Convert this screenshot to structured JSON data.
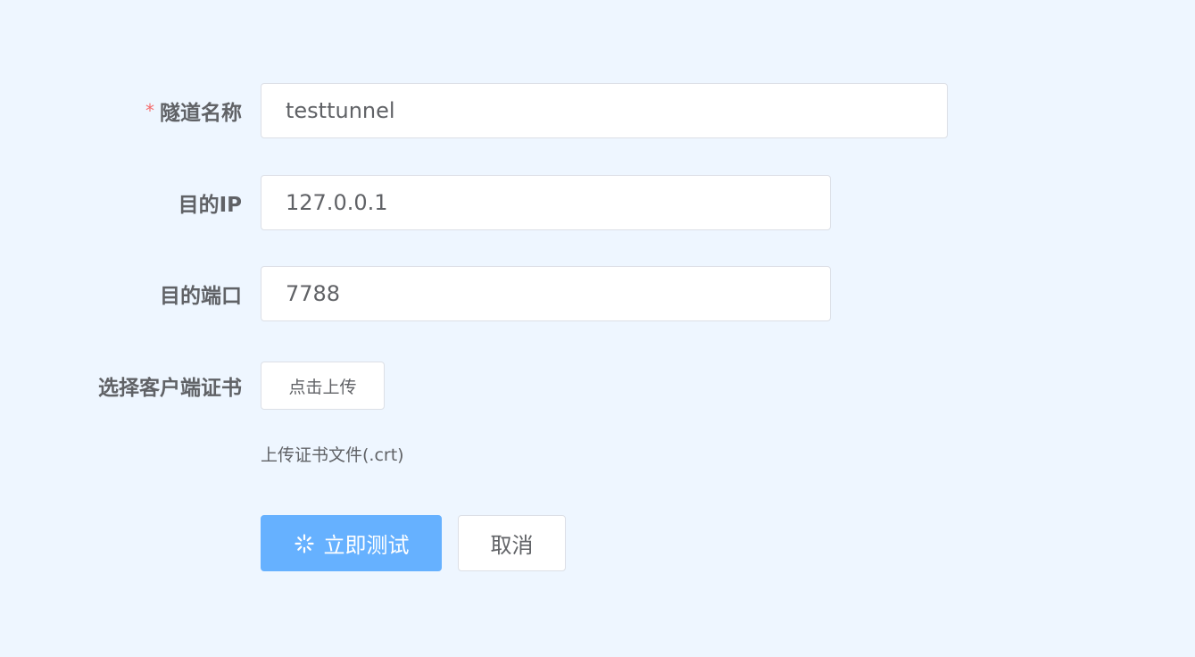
{
  "form": {
    "tunnel_name": {
      "required_mark": "*",
      "label": "隧道名称",
      "value": "testtunnel"
    },
    "dest_ip": {
      "label": "目的IP",
      "value": "127.0.0.1"
    },
    "dest_port": {
      "label": "目的端口",
      "value": "7788"
    },
    "client_cert": {
      "label": "选择客户端证书",
      "upload_button": "点击上传",
      "tip": "上传证书文件(.crt)"
    }
  },
  "actions": {
    "test_label": "立即测试",
    "test_icon": "loading-icon",
    "test_state": "loading",
    "cancel_label": "取消"
  },
  "colors": {
    "background": "#eef6ff",
    "primary_loading": "#66b1ff",
    "required": "#f56c6c",
    "text": "#606266",
    "border": "#dcdfe6"
  }
}
